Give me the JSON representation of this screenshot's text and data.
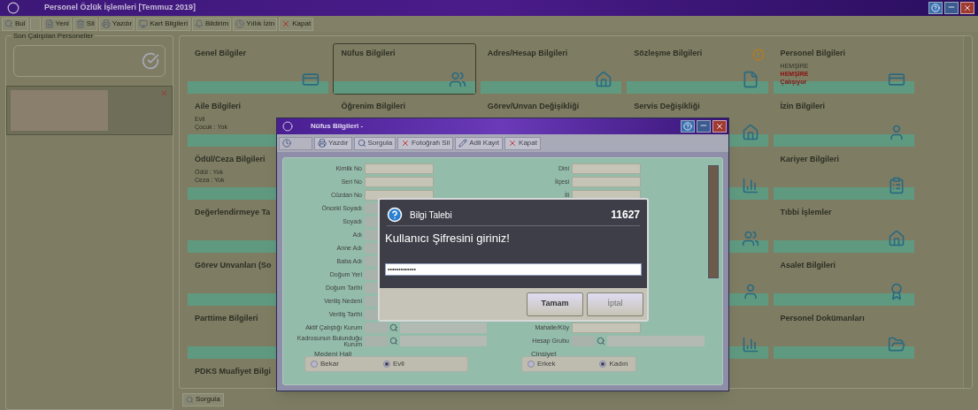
{
  "window": {
    "title": "Personel Özlük İşlemleri [Temmuz 2019]"
  },
  "toolbar": [
    {
      "label": "Bul"
    },
    {
      "label": "Yeni"
    },
    {
      "label": "Sil"
    },
    {
      "label": "Yazdır"
    },
    {
      "label": "Kart Bilgileri"
    },
    {
      "label": "Bildirim"
    },
    {
      "label": "Yıllık İzin"
    },
    {
      "label": "Kapat"
    }
  ],
  "recent": {
    "title": "Son Çalışılan Personeller"
  },
  "card_columns": [
    [
      {
        "title": "Genel Bilgiler",
        "selected": false
      },
      {
        "title": "Aile Bilgileri",
        "selected": false,
        "lines": [
          {
            "text": "Evli",
            "kind": "note"
          },
          {
            "text": "Çocuk : Yok",
            "kind": "note"
          }
        ]
      },
      {
        "title": "Ödül/Ceza Bilgileri",
        "selected": false,
        "lines": [
          {
            "text": "Ödül : Yok",
            "kind": "note"
          },
          {
            "text": "Ceza : Yok",
            "kind": "note"
          }
        ]
      },
      {
        "title": "Değerlendirmeye Ta",
        "selected": false
      },
      {
        "title": "Görev Unvanları (So",
        "selected": false
      },
      {
        "title": "Parttime Bilgileri",
        "selected": false
      },
      {
        "title": "PDKS Muafiyet Bilgi",
        "selected": false
      }
    ],
    [
      {
        "title": "Nüfus Bilgileri",
        "selected": true
      },
      {
        "title": "Öğrenim Bilgileri",
        "selected": false
      }
    ],
    [
      {
        "title": "Adres/Hesap Bilgileri",
        "selected": false
      },
      {
        "title": "Görev/Unvan Değişikliği",
        "selected": false
      }
    ],
    [
      {
        "title": "Sözleşme Bilgileri",
        "selected": false,
        "warning": true
      },
      {
        "title": "Servis Değişikliği",
        "selected": false
      }
    ],
    [
      {
        "title": "Personel Bilgileri",
        "selected": false,
        "lines": [
          {
            "text": "HEMŞİRE",
            "kind": "note"
          },
          {
            "text": "HEMŞİRE",
            "kind": "alert"
          },
          {
            "text": "Çalışıyor",
            "kind": "alert"
          }
        ]
      },
      {
        "title": "İzin Bilgileri",
        "selected": false
      },
      {
        "title": "Kariyer Bilgileri",
        "selected": false
      },
      {
        "title": "Tıbbi İşlemler",
        "selected": false
      },
      {
        "title": "Asalet Bilgileri",
        "selected": false
      },
      {
        "title": "Personel Dokümanları",
        "selected": false
      }
    ]
  ],
  "bottom_bar": {
    "button": "Sorgula"
  },
  "dialog": {
    "title": "Nüfus Bilgileri -",
    "toolbar": [
      {
        "disabled": true
      },
      {
        "label": "Yazdır",
        "disabled": false
      },
      {
        "label": "Sorgula",
        "disabled": false
      },
      {
        "label": "Fotoğrafı Sil",
        "disabled": false
      },
      {
        "label": "Adli Kayıt",
        "disabled": false
      },
      {
        "label": "Kapat",
        "disabled": false
      }
    ],
    "left_fields": [
      {
        "label": "Kimlik No",
        "kind": "text"
      },
      {
        "label": "Seri No",
        "kind": "text"
      },
      {
        "label": "Cüzdan No",
        "kind": "text"
      },
      {
        "label": "Önceki Soyadı",
        "kind": "short"
      },
      {
        "label": "Soyadı",
        "kind": "short"
      },
      {
        "label": "Adı",
        "kind": "short"
      },
      {
        "label": "Anne Adı",
        "kind": "short"
      },
      {
        "label": "Baba Adı",
        "kind": "short"
      },
      {
        "label": "Doğum Yeri",
        "kind": "short"
      },
      {
        "label": "Doğum Tarihi",
        "kind": "short"
      },
      {
        "label": "Veriliş Nedeni",
        "kind": "short"
      },
      {
        "label": "Veriliş Tarihi",
        "kind": "short"
      },
      {
        "label": "Aktif Çalıştığı Kurum",
        "kind": "lookup"
      },
      {
        "label": "Kadrosunun Bulunduğu Kurum",
        "kind": "lookup"
      }
    ],
    "right_fields_top": [
      {
        "label": "Dini",
        "kind": "text"
      },
      {
        "label": "İlçesi",
        "kind": "text"
      },
      {
        "label": "İli",
        "kind": "text"
      }
    ],
    "right_fields_bottom": [
      {
        "label": "Mahalle/Köy",
        "kind": "text"
      },
      {
        "label": "Hesap Grubu",
        "kind": "lookup"
      }
    ],
    "marital": {
      "legend": "Medeni Hali",
      "options": [
        {
          "label": "Bekar",
          "selected": false
        },
        {
          "label": "Evli",
          "selected": true
        }
      ]
    },
    "gender": {
      "legend": "Cinsiyet",
      "options": [
        {
          "label": "Erkek",
          "selected": false
        },
        {
          "label": "Kadın",
          "selected": true
        }
      ]
    }
  },
  "message": {
    "title": "Bilgi Talebi",
    "code": "11627",
    "prompt": "Kullanıcı Şifresini giriniz!",
    "password": "•••••••••••••",
    "buttons": [
      {
        "label": "Tamam",
        "default": true
      },
      {
        "label": "İptal",
        "default": false
      }
    ]
  }
}
